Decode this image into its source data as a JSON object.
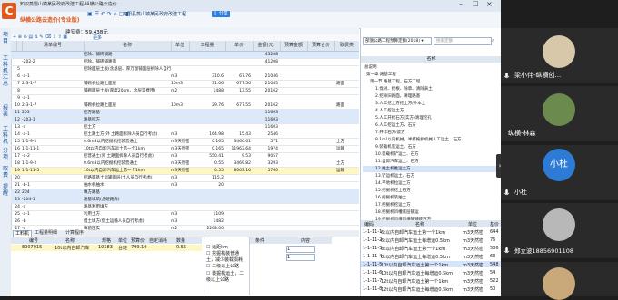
{
  "app": {
    "title": "知识蒸馏山镇某民政府改建工程-纵横公路云造价",
    "subtitle": "纵横公路云造价(专业版)",
    "project_tab": "东阳县蒸山镇某民政府改建工程",
    "share": "分享",
    "cost_label": "建安费：",
    "cost_value": "59,438元",
    "more_btn": "更多",
    "vtabs": [
      "项目",
      "工料机汇总",
      "报表",
      "工料机",
      "分项",
      "取费",
      "提醒"
    ]
  },
  "grid": {
    "headers": [
      "",
      "",
      "清单编号",
      "名称",
      "单位",
      "工程量",
      "单价",
      "金额(元)",
      "预算金额",
      "预算合价",
      "取费类"
    ],
    "rows": [
      {
        "n": "",
        "code": "",
        "name": "挖除、铺砖铺路",
        "unit": "",
        "qty": "",
        "price": "",
        "amount": "43208",
        "fee": "",
        "style": "blue"
      },
      {
        "n": "",
        "code": "-202-2",
        "name": "挖除、铺砖铺路面",
        "unit": "",
        "qty": "",
        "price": "",
        "amount": "41208",
        "fee": ""
      },
      {
        "n": "5",
        "code": "",
        "name": "挖除面层土板(含基层、厚万温铺面层拆除人自行考虑)",
        "unit": "",
        "qty": "",
        "price": "",
        "amount": "",
        "fee": ""
      },
      {
        "n": "6",
        "code": "-a-1",
        "name": "",
        "unit": "m3",
        "qty": "310.6",
        "price": "67.76",
        "amount": "21046",
        "fee": ""
      },
      {
        "n": "7",
        "code": "2-3-1-7",
        "name": "铺砌机拉路土面层",
        "unit": "10m3",
        "qty": "31.06",
        "price": "677.56",
        "amount": "21045",
        "fee": "路面"
      },
      {
        "n": "8",
        "code": "",
        "name": "铺砌面层土板(厚度20cm，含层实费用)",
        "unit": "m2",
        "qty": "1488",
        "price": "13.55",
        "amount": "20162",
        "fee": ""
      },
      {
        "n": "9",
        "code": "-a-1",
        "name": "",
        "unit": "",
        "qty": "",
        "price": "",
        "amount": "",
        "fee": ""
      },
      {
        "n": "10",
        "code": "2-3-1-7",
        "name": "铺砌机拉路土面层",
        "unit": "10m3",
        "qty": "29.76",
        "price": "677.55",
        "amount": "20162",
        "fee": "路面"
      },
      {
        "n": "11",
        "code": "203",
        "name": "挖方路基",
        "unit": "",
        "qty": "",
        "price": "",
        "amount": "11603",
        "fee": "",
        "style": "blue"
      },
      {
        "n": "12",
        "code": "-203-1",
        "name": "路基挖方",
        "unit": "",
        "qty": "",
        "price": "",
        "amount": "11603",
        "fee": "",
        "style": "blue"
      },
      {
        "n": "13",
        "code": "-a",
        "name": "挖土方",
        "unit": "",
        "qty": "",
        "price": "",
        "amount": "11603",
        "fee": ""
      },
      {
        "n": "14",
        "code": "-a-1",
        "name": "挖土路土方(外 土路面拆除人员自行考虑)",
        "unit": "m3",
        "qty": "164.98",
        "price": "15.43",
        "amount": "2546",
        "fee": ""
      },
      {
        "n": "15",
        "code": "1-1-9-2",
        "name": "0.6m3以内挖掘机挖装普通土",
        "unit": "m3天然密",
        "qty": "0.165",
        "price": "3460.61",
        "amount": "571",
        "fee": "土方"
      },
      {
        "n": "16",
        "code": "1-1-11-1",
        "name": "10t以内自卸汽车运土第一个1km",
        "unit": "m3天然密",
        "qty": "0.165",
        "price": "11963.64",
        "amount": "1974",
        "fee": "运输"
      },
      {
        "n": "17",
        "code": "-a-2",
        "name": "挖普通土(外 土路面拆除人员自行考虑)",
        "unit": "m3",
        "qty": "550.41",
        "price": "9.53",
        "amount": "9057",
        "fee": ""
      },
      {
        "n": "18",
        "code": "1-1-9-2",
        "name": "0.6m3以内挖掘机挖装普通土",
        "unit": "m3天然密",
        "qty": "0.55",
        "price": "3469.82",
        "amount": "3293",
        "fee": "土方"
      },
      {
        "n": "19",
        "code": "1-1-11-5",
        "name": "10t以内自卸汽车运土第一个1km",
        "unit": "m3天然密",
        "qty": "0.55",
        "price": "8063.16",
        "amount": "5760",
        "fee": "运输",
        "style": "sel"
      },
      {
        "n": "20",
        "code": "",
        "name": "挖路面基土运输面层(土人员自行考虑)",
        "unit": "m3",
        "qty": "115.2",
        "price": "",
        "amount": "",
        "fee": ""
      },
      {
        "n": "21",
        "code": "-b-1",
        "name": "抽水机抽水",
        "unit": "m3",
        "qty": "20",
        "price": "",
        "amount": "",
        "fee": ""
      },
      {
        "n": "22",
        "code": "204",
        "name": "填方路基",
        "unit": "",
        "qty": "",
        "price": "",
        "amount": "",
        "fee": "",
        "style": "blue"
      },
      {
        "n": "23",
        "code": "-204-1",
        "name": "路基填筑(含硬路肩)",
        "unit": "",
        "qty": "",
        "price": "",
        "amount": "",
        "fee": "",
        "style": "blue"
      },
      {
        "n": "24",
        "code": "-a",
        "name": "路基利用填方",
        "unit": "",
        "qty": "",
        "price": "",
        "amount": "",
        "fee": ""
      },
      {
        "n": "25",
        "code": "-a-1",
        "name": "利用土方",
        "unit": "m3",
        "qty": "1109",
        "price": "",
        "amount": "",
        "fee": ""
      },
      {
        "n": "26",
        "code": "-b",
        "name": "借土填方(借土运输人员自行考虑)",
        "unit": "m3",
        "qty": "1482",
        "price": "",
        "amount": "",
        "fee": ""
      },
      {
        "n": "27",
        "code": "-c",
        "name": "填前压实",
        "unit": "m2",
        "qty": "2268.00",
        "price": "",
        "amount": "",
        "fee": ""
      }
    ]
  },
  "right_panel": {
    "dropdown": "部颁公路工程预算定额(2018)",
    "search_placeholder": "搜索定额",
    "tree_header": "名称",
    "tree": [
      "总说明",
      "第一章 路基工程",
      "第一节 路基工程，石方工程",
      "1.伐树、挖根、除草、清除表土",
      "2.挖除旧路面，清理路基",
      "3.人工挖土方挖土方/外本土",
      "4.人工挖运土方",
      "5.人工开挖石方(实方)清理挖孔",
      "6.人工挖运土方，石方",
      "7.开炸石方/废方",
      "8.1m³以内机械，半挤拖扒机械人工运土、石方",
      "9.装载机装运土、石方",
      "10.装载机铲运土、石方",
      "11.自卸汽车运土、石方",
      "12.推土机推运土方",
      "13.铲运机运土、石方",
      "14.平地机拉运土方",
      "15.挖掘机挖土石方",
      "16.挖掘机装拍土",
      "17.挖掘机挖运土方",
      "18.挖掘机凹槽底层铺运",
      "19.挖掘机凹槽凹槽铺铺砖石方"
    ]
  },
  "right_bottom": {
    "headers": [
      "编码",
      "名称",
      "单位",
      "基价"
    ],
    "rows": [
      {
        "code": "1-1-11-1",
        "name": "6t以内自卸汽车运土第一个1km",
        "unit": "m3天然密",
        "price": "644"
      },
      {
        "code": "1-1-11-2",
        "name": "6t以内自卸汽车运土每增运0.5km",
        "unit": "m3天然密",
        "price": "76"
      },
      {
        "code": "1-1-11-3",
        "name": "8t以内自卸汽车运土第一个1km",
        "unit": "m3天然密",
        "price": "586"
      },
      {
        "code": "1-1-11-4",
        "name": "8t以内自卸汽车运土每增运0.5km",
        "unit": "m3天然密",
        "price": "63"
      },
      {
        "code": "1-1-11-5",
        "name": "10t以内自卸汽车运土第一个1km",
        "unit": "m3天然密",
        "price": "548"
      },
      {
        "code": "1-1-11-6",
        "name": "10t以内自卸汽车运土每增运0.5km",
        "unit": "m3天然密",
        "price": "54"
      },
      {
        "code": "1-1-11-7",
        "name": "12t以内自卸汽车运土第一个1km",
        "unit": "m3天然密",
        "price": "522"
      },
      {
        "code": "1-1-11-8",
        "name": "12t以内自卸汽车运土每增运0.5km",
        "unit": "m3天然密",
        "price": "50"
      }
    ]
  },
  "bottom": {
    "tabs": [
      "工料机",
      "工程量明细",
      "计算程序"
    ],
    "headers": [
      "编号",
      "名称",
      "规格",
      "单位",
      "预算价",
      "自定消耗",
      "数量"
    ],
    "row": {
      "code": "8007015",
      "name": "10t以内自卸汽车",
      "spec": "10583",
      "unit": "台班",
      "price": "799.19",
      "qty": "0.55"
    },
    "options": [
      "运距km",
      "挖掘机装普通土，减少装载损耗",
      "二级以上公路",
      "装掘机运土，二级以上公路"
    ],
    "sub_header": [
      "条件",
      "内容"
    ],
    "sub_rows": [
      "1",
      "1"
    ]
  },
  "video": {
    "participants": [
      {
        "name": "梁小伟-纵横创...",
        "avatar_color": "#d6c8a8"
      },
      {
        "name": "纵横-林森",
        "avatar_color": "#6a8a4e"
      },
      {
        "name": "小杜",
        "avatar_text": "小杜",
        "avatar_color": "#2e7bd6"
      },
      {
        "name": "郑立波18856901108",
        "avatar_color": "#b8b8b8"
      },
      {
        "name": "",
        "avatar_color": "#c9a87a"
      }
    ]
  }
}
